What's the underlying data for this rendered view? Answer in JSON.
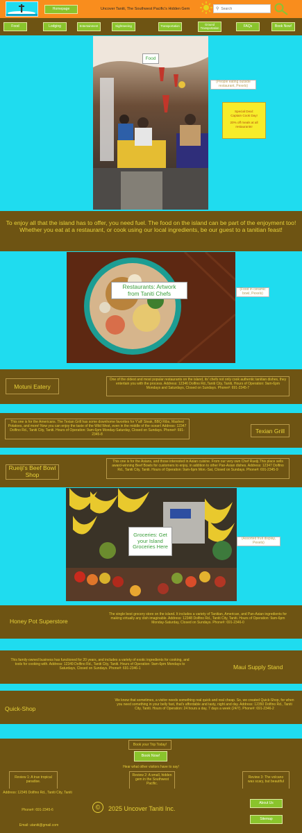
{
  "header": {
    "homepage_label": "Homepage",
    "site_title": "Uncover Taniti, The Southwest Pacific's Hidden Gem",
    "search_placeholder": "Search"
  },
  "nav": {
    "items": [
      "Food",
      "Lodging",
      "Entertainment",
      "Sightseeing",
      "Transportation",
      "Ground Transportation",
      "FAQs",
      "Book Now!"
    ]
  },
  "hero": {
    "food_tag": "Food",
    "people_eating_caption": "(People eating outside restaurant, Pexels)",
    "special_deal": {
      "line1": "Special Deal:",
      "line2": "Captain Cook Day!",
      "line3": "20% off meals at all restaurants!"
    }
  },
  "intro_text": "To enjoy all that the island has to offer, you need fuel. The food on the island can be part of the enjoyment too! Whether you eat at a restaurant, or cook using our local ingredients, be our guest to a tanitian feast!",
  "restaurants_section": {
    "overlay": "Restaurants: Artwork from Taniti Chefs",
    "caption": "(Food in ceramic bowl, Pexels)"
  },
  "restaurants": [
    {
      "name": "Motuni Eatery",
      "description": "One of the oldest and most popular restaurants on the island, its' chefs not only cook authentic tanitian dishes, they entertain you with the process. Address: 12346 Dolfino Rd.,Taniti City, Taniti, Hours of Operation: 9am-6pm Mondays and Saturdays, Closed on Sundays. Phone#: 691-2345-7"
    },
    {
      "name": "Texian Grill",
      "description": "This one is for the Americans. The Texian Grill has some downhome favorites for Y'all! Steak, BBQ Ribs, Mashed Potatoes, and more! Now you can enjoy the taste of the Wild West, even in the middle of the ocean! Address: 12347 Dolfino Rd., Taniti City, Taniti. Hours of Operation: 9am-6pm Monday-Saturday, Closed on Sundays. Phone#: 691-2345-8"
    },
    {
      "name": "Rueiji's Beef Bowl Shop",
      "description": "This one is for the Asians, and those interested in Asian cuisine. From our very own Chef Rueiji,This place sells award-winning Beef Bowls for customers to enjoy, in addition to other Pan-Asian dishes. Address: 12347 Dolfino Rd., Taniti City, Taniti. Hours of Operation: 9am-6pm Mon.-Sat, Closed on Sundays. Phone#: 691-2345-9"
    }
  ],
  "groceries_section": {
    "overlay": "Groceries: Get your Island Groceries Here",
    "caption": "(Assorted fruit display, Pexels)"
  },
  "groceries": [
    {
      "name": "Honey Pot Superstore",
      "description": "The single best grocery store on the island. It includes a variety of Tanitian, American, and Pan-Asian ingredients for making virtually any dish imaginable. Address: 12348 Dolfino Rd., Taniti City, Taniti. Hours of Operation: 9am-6pm Monday-Saturday, Closed on Sundays. Phone#: 691-2346-0"
    },
    {
      "name": "Maui Supply Stand",
      "description": "This family-owned business has functioned for 20 years, and includes a variety of exotic ingredients for cooking, and tools for cooking with. Address: 12349 Dolfino Rd., Taniti City, Taniti. Hours of Operation: 9am-6pm Mondays to Saturdays, Closed on Sundays. Phone#: 691-2346-1"
    },
    {
      "name": "Quick-Shop",
      "description": "We know that sometimes, a visitor needs something real quick and real cheap. So, we created Quick-Shop, for when you need something in your belly fast, that's affordable and tasty, night and day. Address: 12350 Dolfino Rd., Taniti City, Taniti. Hours of Operation: 24 hours a day, 7 days a week (24/7). Phone#: 691-2346-2"
    }
  ],
  "booking": {
    "prompt": "Book your Trip Today!",
    "button": "Book Now!",
    "reviews_heading": "Hear what other visitors have to say!",
    "reviews": [
      "Review 1: A true tropical paradise.",
      "Review 2: A small, hidden gem in the Southwest Pacific.",
      "Review 3: The volcano was scary, but beautiful"
    ]
  },
  "footer": {
    "address": "Address: 12345 Dolfino Rd., Taniti City, Taniti",
    "phone": "Phone#: 691-2345-6",
    "email": "Email: utaniti@gmail.com",
    "copyright_symbol": "©",
    "copyright": "2025 Uncover Taniti Inc.",
    "about_us": "About Us",
    "sitemap": "Sitemap"
  }
}
